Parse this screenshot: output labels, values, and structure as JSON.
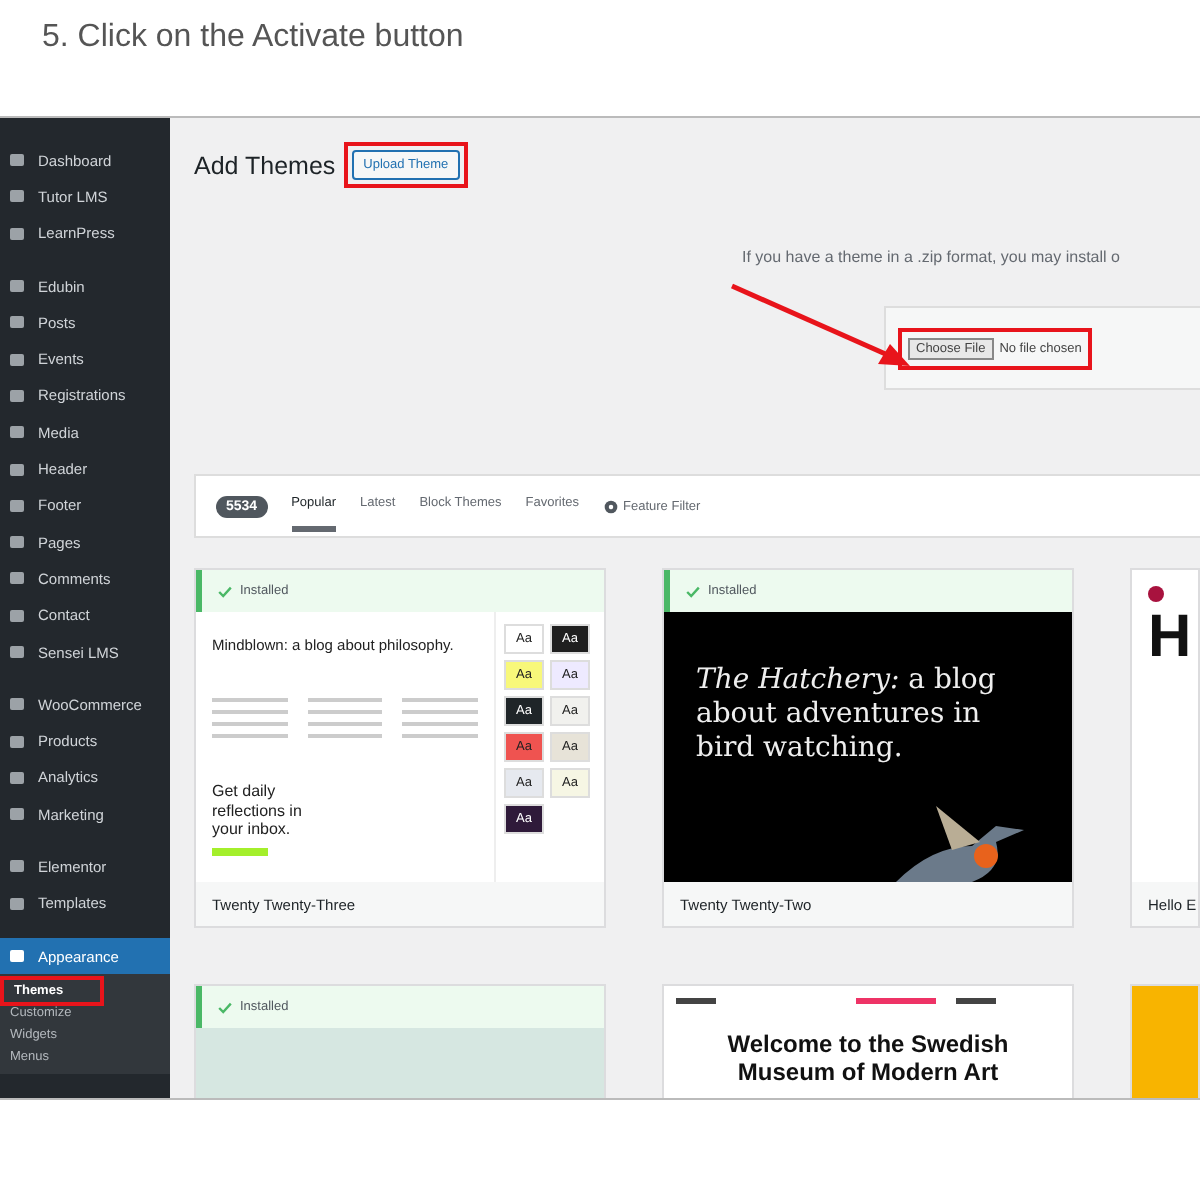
{
  "caption": "5. Click on the Activate button",
  "sidebar": {
    "groups": [
      [
        {
          "label": "Dashboard",
          "selected": false
        },
        {
          "label": "Tutor LMS",
          "selected": false
        },
        {
          "label": "LearnPress",
          "selected": false
        }
      ],
      [
        {
          "label": "Edubin",
          "selected": false
        },
        {
          "label": "Posts",
          "selected": false
        },
        {
          "label": "Events",
          "selected": false
        },
        {
          "label": "Registrations",
          "selected": false
        },
        {
          "label": "Media",
          "selected": false
        },
        {
          "label": "Header",
          "selected": false
        },
        {
          "label": "Footer",
          "selected": false
        },
        {
          "label": "Pages",
          "selected": false
        },
        {
          "label": "Comments",
          "selected": false
        },
        {
          "label": "Contact",
          "selected": false
        },
        {
          "label": "Sensei LMS",
          "selected": false
        }
      ],
      [
        {
          "label": "WooCommerce",
          "selected": false
        },
        {
          "label": "Products",
          "selected": false
        },
        {
          "label": "Analytics",
          "selected": false
        },
        {
          "label": "Marketing",
          "selected": false
        }
      ],
      [
        {
          "label": "Elementor",
          "selected": false
        },
        {
          "label": "Templates",
          "selected": false
        }
      ],
      [
        {
          "label": "Appearance",
          "selected": true
        }
      ]
    ],
    "submenu": [
      {
        "label": "Themes",
        "selected": true,
        "highlighted": true
      },
      {
        "label": "Customize",
        "selected": false,
        "highlighted": false
      },
      {
        "label": "Widgets",
        "selected": false,
        "highlighted": false
      },
      {
        "label": "Menus",
        "selected": false,
        "highlighted": false
      }
    ]
  },
  "header": {
    "title": "Add Themes",
    "upload_button": {
      "label": "Upload Theme",
      "highlighted": true
    }
  },
  "upload": {
    "description": "If you have a theme in a .zip format, you may install o",
    "choose_button": {
      "label": "Choose File",
      "highlighted": true
    },
    "file_status": "No file chosen"
  },
  "filter_bar": {
    "count": "5534",
    "tabs": [
      {
        "label": "Popular",
        "selected": true
      },
      {
        "label": "Latest",
        "selected": false
      },
      {
        "label": "Block Themes",
        "selected": false
      },
      {
        "label": "Favorites",
        "selected": false
      }
    ],
    "feature_filter": "Feature Filter"
  },
  "themes": [
    {
      "kind": "tt3",
      "installed": true,
      "installed_label": "Installed",
      "name": "Twenty Twenty-Three",
      "headline": "Mindblown: a blog about philosophy.",
      "subscribe": "Get daily reflections in your inbox.",
      "swatches": [
        {
          "label": "Aa",
          "color": "#ffffff"
        },
        {
          "label": "Aa",
          "color": "#1f1f1f"
        },
        {
          "label": "Aa",
          "color": "#f8f87a"
        },
        {
          "label": "Aa",
          "color": "#eeeaff"
        },
        {
          "label": "Aa",
          "color": "#1f2528"
        },
        {
          "label": "Aa",
          "color": "#f1f1ee"
        },
        {
          "label": "Aa",
          "color": "#ef5350"
        },
        {
          "label": "Aa",
          "color": "#e7e3d8"
        },
        {
          "label": "Aa",
          "color": "#e6e9ef"
        },
        {
          "label": "Aa",
          "color": "#f6f6e4"
        },
        {
          "label": "Aa",
          "color": "#2f1a3a"
        }
      ]
    },
    {
      "kind": "tt2",
      "installed": true,
      "installed_label": "Installed",
      "name": "Twenty Twenty-Two",
      "headline": "*The Hatchery:* a blog about adventures in bird watching."
    },
    {
      "kind": "hello",
      "installed": false,
      "name": "Hello E",
      "headline": "H"
    },
    {
      "kind": "teal",
      "installed": true,
      "installed_label": "Installed"
    },
    {
      "kind": "museum",
      "installed": false,
      "headline": "Welcome to the Swedish Museum of Modern Art"
    },
    {
      "kind": "yellow",
      "installed": false
    }
  ]
}
